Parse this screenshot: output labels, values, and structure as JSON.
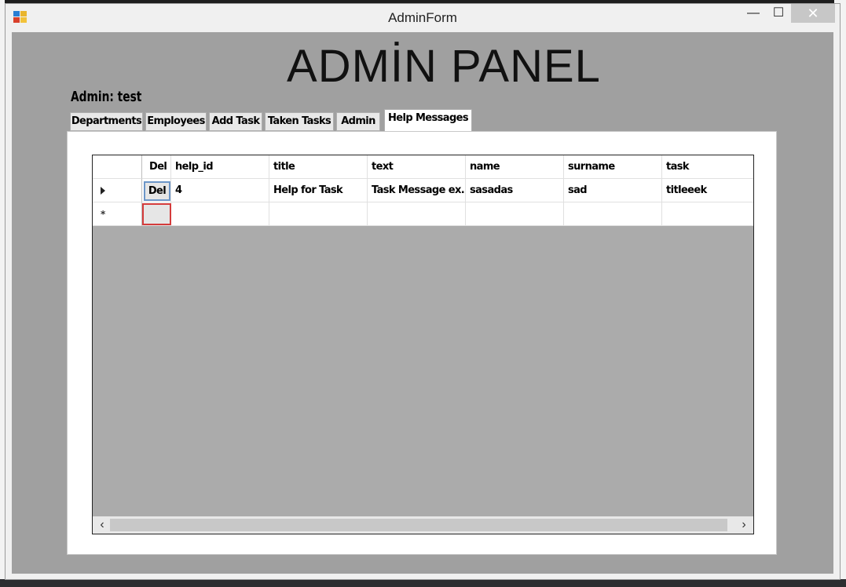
{
  "window": {
    "title": "AdminForm",
    "min_symbol": "—",
    "max_symbol": "☐",
    "close_symbol": "✕"
  },
  "header": {
    "panel_title": "ADMİN PANEL",
    "admin_label": "Admin: test"
  },
  "tabs": [
    {
      "label": "Departments"
    },
    {
      "label": "Employees"
    },
    {
      "label": "Add Task"
    },
    {
      "label": "Taken Tasks"
    },
    {
      "label": "Admin"
    },
    {
      "label": "Help Messages",
      "active": true
    }
  ],
  "grid": {
    "columns": [
      "Del",
      "help_id",
      "title",
      "text",
      "name",
      "surname",
      "task"
    ],
    "rows": [
      {
        "del": "Del",
        "help_id": "4",
        "title": "Help for Task",
        "text": "Task Message ex...",
        "name": "sasadas",
        "surname": "sad",
        "task": "titleeek"
      }
    ],
    "new_row_marker": "*",
    "scroll_left": "‹",
    "scroll_right": "›"
  },
  "colors": {
    "client_bg": "#a0a0a0",
    "grid_bg": "#ababab",
    "selected_cell_border": "#6c96c8",
    "new_cell_border": "#d43b3b"
  }
}
